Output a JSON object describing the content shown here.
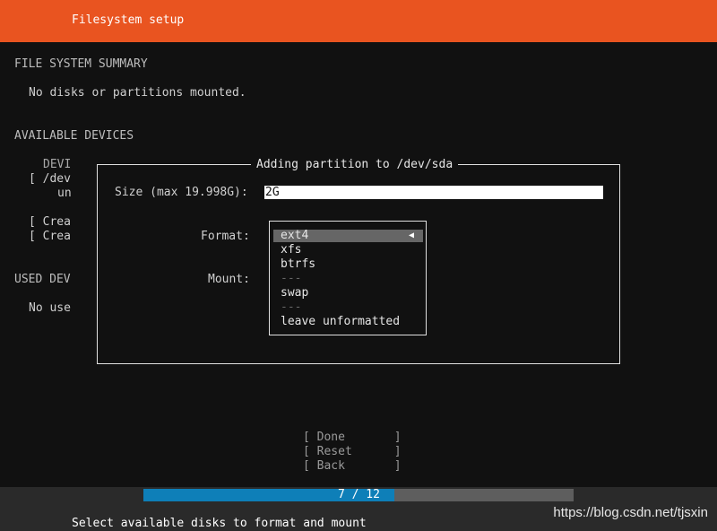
{
  "header": {
    "title": "Filesystem setup"
  },
  "summary": {
    "heading": "FILE SYSTEM SUMMARY",
    "empty_text": "No disks or partitions mounted."
  },
  "available": {
    "heading": "AVAILABLE DEVICES",
    "col1": "DEVI",
    "row1": "[ /dev",
    "row1b": "un",
    "action1": "[ Crea",
    "action2": "[ Crea"
  },
  "used": {
    "heading": "USED DEV",
    "empty_text": "No use"
  },
  "dialog": {
    "title": "Adding partition to /dev/sda",
    "size_label": "Size (max 19.998G):",
    "size_value": "2G",
    "format_label": "Format:",
    "mount_label": "Mount:",
    "format_options": [
      "ext4",
      "xfs",
      "btrfs",
      "---",
      "swap",
      "---",
      "leave unformatted"
    ],
    "selected_arrow": "◀"
  },
  "buttons": {
    "done": "[ Done       ]",
    "reset": "[ Reset      ]",
    "back": "[ Back       ]"
  },
  "progress": {
    "text": "7 / 12",
    "current": 7,
    "total": 12
  },
  "status": "Select available disks to format and mount",
  "watermark": "https://blog.csdn.net/tjsxin",
  "colors": {
    "accent": "#e95420",
    "progress": "#0e7fb8",
    "background": "#111111"
  }
}
